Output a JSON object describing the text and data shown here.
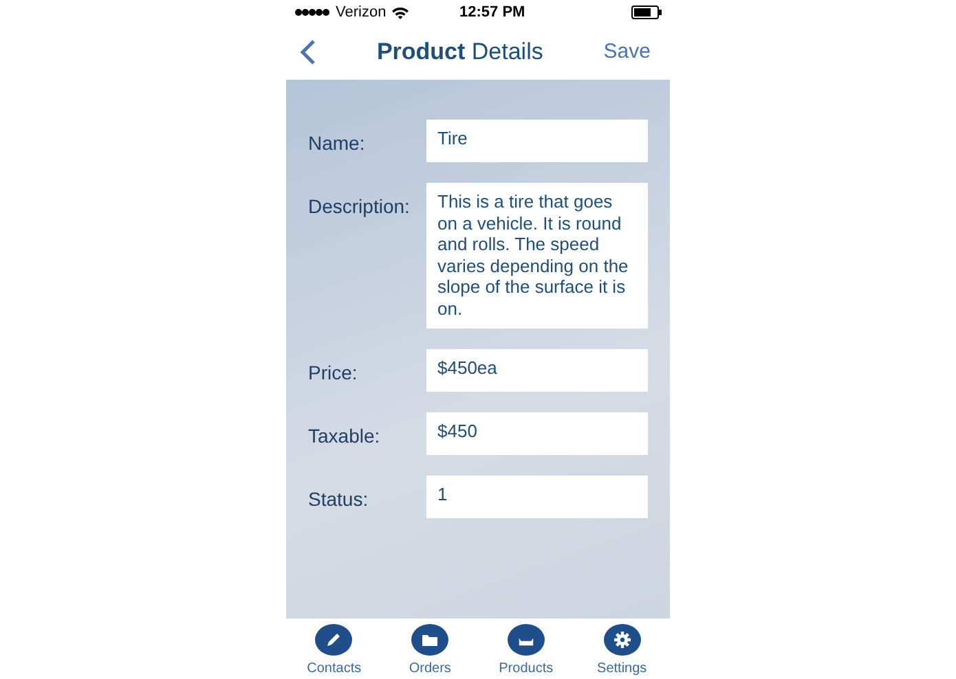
{
  "status_bar": {
    "carrier": "Verizon",
    "time": "12:57 PM"
  },
  "nav_bar": {
    "title": "**Product** Details",
    "action": "Save"
  },
  "fields": [
    {
      "label": "Name:",
      "value": "Tire"
    },
    {
      "label": "Description:",
      "value": "This is a tire that goes on a vehicle. It is round and rolls. The speed varies depending on the slope of the surface it is on."
    },
    {
      "label": "Price:",
      "value": "$450ea"
    },
    {
      "label": "Taxable:",
      "value": "$450"
    },
    {
      "label": "Status:",
      "value": "1"
    }
  ],
  "tab_bar": [
    {
      "label": "Contacts",
      "kind": "pencil"
    },
    {
      "label": "Orders",
      "kind": "folder"
    },
    {
      "label": "Products",
      "kind": "tray"
    },
    {
      "label": "Settings",
      "kind": "gear"
    }
  ]
}
